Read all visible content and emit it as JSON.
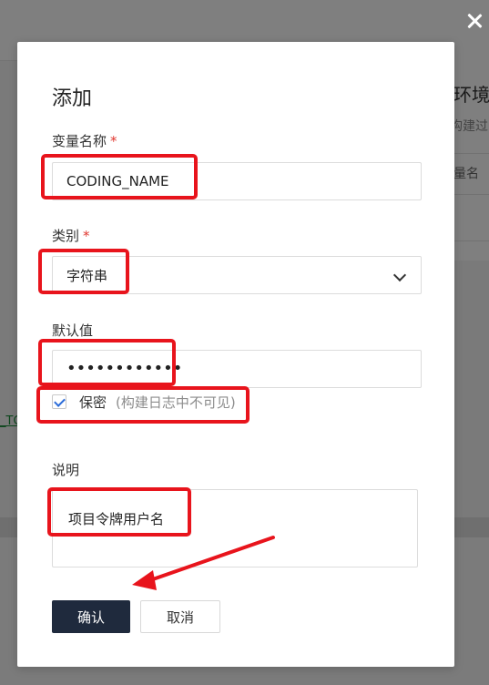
{
  "background": {
    "section_title": "程环境",
    "section_subtitle": "构建过",
    "column_header": "量名",
    "link_text": "_TO"
  },
  "modal": {
    "title": "添加",
    "fields": {
      "name_label": "变量名称",
      "name_value": "CODING_NAME",
      "category_label": "类别",
      "category_value": "字符串",
      "default_label": "默认值",
      "default_value": "••••••••••••",
      "secret_label": "保密",
      "secret_hint": "(构建日志中不可见)",
      "secret_checked": true,
      "description_label": "说明",
      "description_value": "项目令牌用户名",
      "required_mark": "*"
    },
    "buttons": {
      "confirm": "确认",
      "cancel": "取消"
    }
  },
  "colors": {
    "annotation": "#e8141c",
    "primary_button": "#1f2a3d",
    "required": "#e0362e"
  }
}
